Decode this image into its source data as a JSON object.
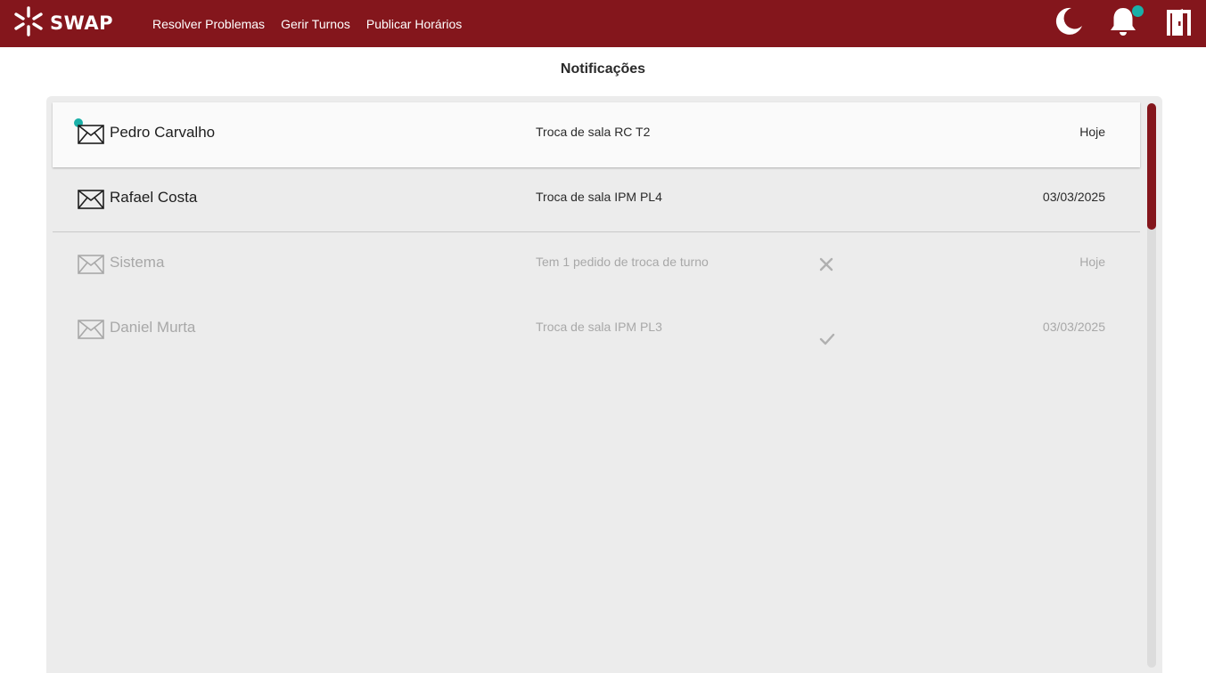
{
  "app": {
    "brand": "SWAP"
  },
  "nav": {
    "items": [
      {
        "label": "Resolver Problemas"
      },
      {
        "label": "Gerir Turnos"
      },
      {
        "label": "Publicar Horários"
      }
    ]
  },
  "header_icons": [
    "moon-icon",
    "bell-icon",
    "logout-door-icon"
  ],
  "page": {
    "title": "Notificações"
  },
  "notifications": [
    {
      "sender": "Pedro Carvalho",
      "subject": "Troca de sala RC T2",
      "date": "Hoje",
      "unread": true,
      "state": "active",
      "icon": "mail-icon"
    },
    {
      "sender": "Rafael Costa",
      "subject": "Troca de sala IPM PL4",
      "date": "03/03/2025",
      "unread": false,
      "state": "read",
      "icon": "mail-icon"
    },
    {
      "sender": "Sistema",
      "subject": "Tem 1 pedido de troca de turno",
      "date": "Hoje",
      "unread": false,
      "state": "muted",
      "icon": "mail-icon",
      "action_icon": "close-x-icon"
    },
    {
      "sender": "Daniel Murta",
      "subject": "Troca de sala IPM PL3",
      "date": "03/03/2025",
      "unread": false,
      "state": "muted",
      "icon": "mail-icon",
      "action_icon": "checkmark-icon"
    }
  ],
  "colors": {
    "brand": "#84161c",
    "accent_dot": "#1ab0a8",
    "panel_bg": "#ececec",
    "scroll_thumb": "#84161c",
    "muted_text": "#a8a8a8"
  }
}
